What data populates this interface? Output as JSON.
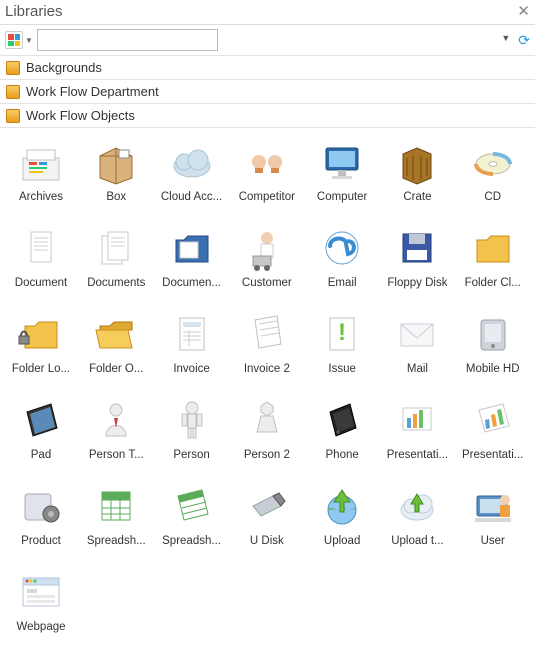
{
  "panel": {
    "title": "Libraries"
  },
  "search": {
    "value": ""
  },
  "categories": [
    {
      "label": "Backgrounds"
    },
    {
      "label": "Work Flow Department"
    },
    {
      "label": "Work Flow Objects"
    }
  ],
  "items": [
    {
      "label": "Archives",
      "icon": "archives"
    },
    {
      "label": "Box",
      "icon": "box"
    },
    {
      "label": "Cloud Acc...",
      "icon": "cloud"
    },
    {
      "label": "Competitor",
      "icon": "competitor"
    },
    {
      "label": "Computer",
      "icon": "computer"
    },
    {
      "label": "Crate",
      "icon": "crate"
    },
    {
      "label": "CD",
      "icon": "cd"
    },
    {
      "label": "Document",
      "icon": "doc"
    },
    {
      "label": "Documents",
      "icon": "docs"
    },
    {
      "label": "Documen...",
      "icon": "docfolder"
    },
    {
      "label": "Customer",
      "icon": "customer"
    },
    {
      "label": "Email",
      "icon": "email"
    },
    {
      "label": "Floppy Disk",
      "icon": "floppy"
    },
    {
      "label": "Folder Cl...",
      "icon": "folderclosed"
    },
    {
      "label": "Folder Lo...",
      "icon": "folderlocked"
    },
    {
      "label": "Folder O...",
      "icon": "folderopen"
    },
    {
      "label": "Invoice",
      "icon": "invoice"
    },
    {
      "label": "Invoice 2",
      "icon": "invoice2"
    },
    {
      "label": "Issue",
      "icon": "issue"
    },
    {
      "label": "Mail",
      "icon": "mail"
    },
    {
      "label": "Mobile HD",
      "icon": "mobilehd"
    },
    {
      "label": "Pad",
      "icon": "pad"
    },
    {
      "label": "Person T...",
      "icon": "persont"
    },
    {
      "label": "Person",
      "icon": "person"
    },
    {
      "label": "Person 2",
      "icon": "person2"
    },
    {
      "label": "Phone",
      "icon": "phone"
    },
    {
      "label": "Presentati...",
      "icon": "present1"
    },
    {
      "label": "Presentati...",
      "icon": "present2"
    },
    {
      "label": "Product",
      "icon": "product"
    },
    {
      "label": "Spreadsh...",
      "icon": "spread1"
    },
    {
      "label": "Spreadsh...",
      "icon": "spread2"
    },
    {
      "label": "U Disk",
      "icon": "udisk"
    },
    {
      "label": "Upload",
      "icon": "upload"
    },
    {
      "label": "Upload t...",
      "icon": "uploadcloud"
    },
    {
      "label": "User",
      "icon": "user"
    },
    {
      "label": "Webpage",
      "icon": "webpage"
    }
  ]
}
